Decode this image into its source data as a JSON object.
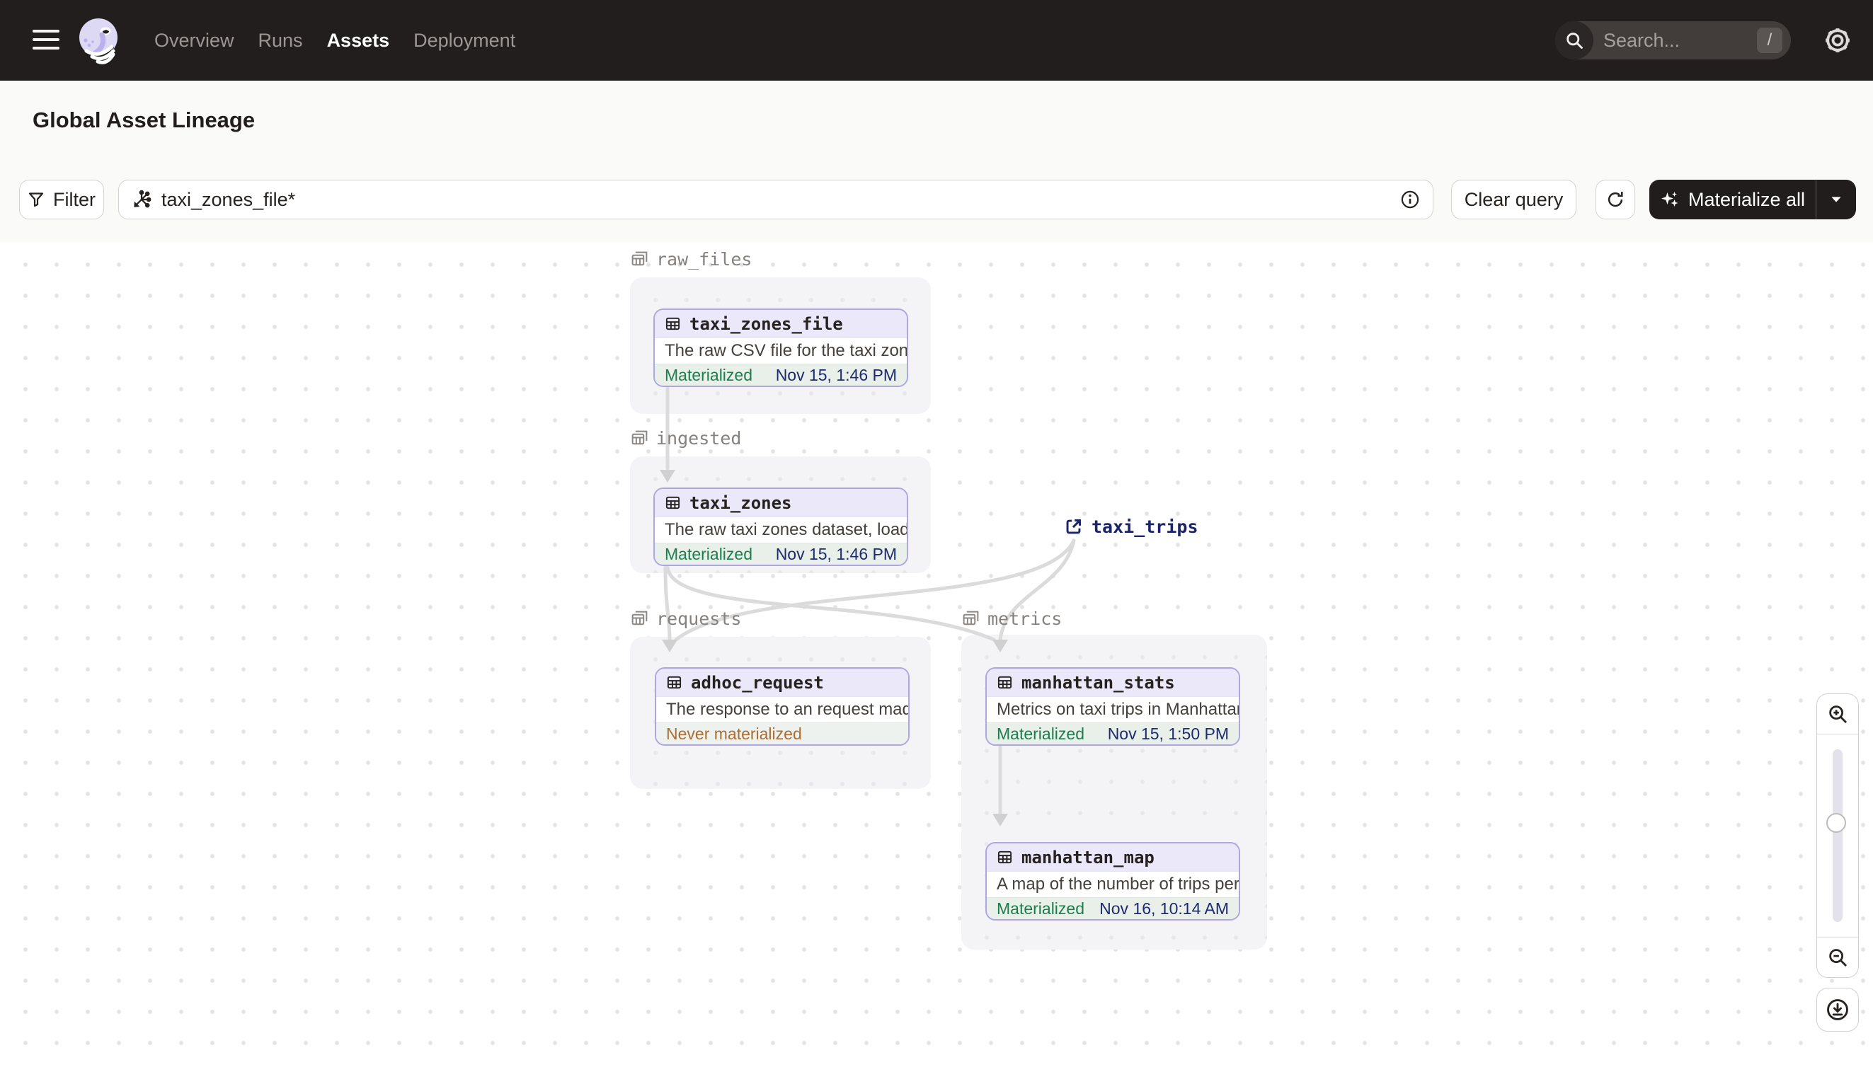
{
  "nav": {
    "items": [
      {
        "label": "Overview",
        "active": false
      },
      {
        "label": "Runs",
        "active": false
      },
      {
        "label": "Assets",
        "active": true
      },
      {
        "label": "Deployment",
        "active": false
      }
    ],
    "search": {
      "placeholder": "Search...",
      "shortcut": "/"
    }
  },
  "header": {
    "title": "Global Asset Lineage",
    "reload_button": "Reload definitions"
  },
  "toolbar": {
    "filter_label": "Filter",
    "query_value": "taxi_zones_file*",
    "clear_query_label": "Clear query",
    "materialize_label": "Materialize all"
  },
  "graph": {
    "groups": [
      {
        "name": "raw_files"
      },
      {
        "name": "ingested"
      },
      {
        "name": "requests"
      },
      {
        "name": "metrics"
      }
    ],
    "nodes": [
      {
        "name": "taxi_zones_file",
        "group": "raw_files",
        "description": "The raw CSV file for the taxi zones dat...",
        "status": "Materialized",
        "timestamp": "Nov 15, 1:46 PM"
      },
      {
        "name": "taxi_zones",
        "group": "ingested",
        "description": "The raw taxi zones dataset, loaded int...",
        "status": "Materialized",
        "timestamp": "Nov 15, 1:46 PM"
      },
      {
        "name": "adhoc_request",
        "group": "requests",
        "description": "The response to an request made in th...",
        "status": "Never materialized",
        "timestamp": ""
      },
      {
        "name": "manhattan_stats",
        "group": "metrics",
        "description": "Metrics on taxi trips in Manhattan",
        "status": "Materialized",
        "timestamp": "Nov 15, 1:50 PM"
      },
      {
        "name": "manhattan_map",
        "group": "metrics",
        "description": "A map of the number of trips per taxi z...",
        "status": "Materialized",
        "timestamp": "Nov 16, 10:14 AM"
      }
    ],
    "external_asset": {
      "name": "taxi_trips"
    },
    "edges": [
      "taxi_zones_file -> taxi_zones",
      "taxi_zones -> adhoc_request",
      "taxi_zones -> manhattan_stats",
      "taxi_trips -> adhoc_request",
      "taxi_trips -> manhattan_stats",
      "manhattan_stats -> manhattan_map"
    ]
  },
  "colors": {
    "nav_background": "#221e1d",
    "node_border": "#aea6e3",
    "node_header_bg": "#ebe8fa",
    "materialized_green": "#1c7d4d",
    "never_materialized_orange": "#ac6d33",
    "timestamp_navy": "#1d2a70",
    "edge_gray": "#dcdbdb"
  },
  "icons": {
    "menu": "hamburger-icon",
    "logo": "dagster-logo",
    "search": "search-icon",
    "settings": "gear-icon",
    "reload": "refresh-icon",
    "filter": "funnel-icon",
    "query": "asset-selector-icon",
    "info": "info-icon",
    "materialize": "sparkles-icon",
    "caret": "chevron-down-icon",
    "asset": "table-icon",
    "group": "asset-group-icon",
    "external": "external-link-icon",
    "zoom_in": "zoom-in-icon",
    "zoom_out": "zoom-out-icon",
    "download": "download-icon"
  }
}
